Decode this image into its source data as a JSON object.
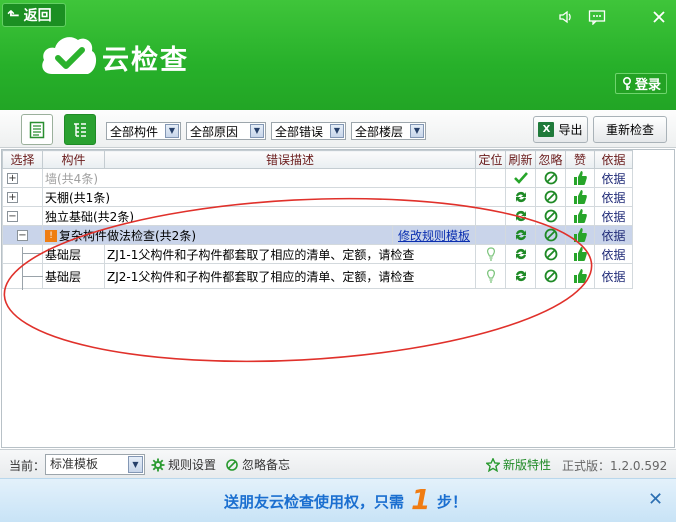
{
  "header": {
    "back_label": "返回",
    "title": "云检查",
    "login_label": "登录",
    "controls": [
      "speaker-icon",
      "message-icon",
      "close-icon"
    ],
    "bg_color": "#2bb22d"
  },
  "toolbar": {
    "filters": [
      "全部构件",
      "全部原因",
      "全部错误",
      "全部楼层"
    ],
    "export_label": "导出",
    "recheck_label": "重新检查"
  },
  "table": {
    "columns": [
      "选择",
      "构件",
      "错误描述",
      "定位",
      "刷新",
      "忽略",
      "赞",
      "依据"
    ],
    "rows": [
      {
        "component": "墙(共4条)",
        "grayed": true,
        "basis": "依据"
      },
      {
        "component": "天棚(共1条)",
        "basis": "依据"
      },
      {
        "component": "独立基础(共2条)",
        "basis": "依据"
      },
      {
        "group": "复杂构件做法检查(共2条)",
        "link": "修改规则模板",
        "basis": "依据"
      },
      {
        "component": "基础层",
        "description": "ZJ1-1父构件和子构件都套取了相应的清单、定额，请检查",
        "basis": "依据"
      },
      {
        "component": "基础层",
        "description": "ZJ2-1父构件和子构件都套取了相应的清单、定额，请检查",
        "basis": "依据"
      }
    ]
  },
  "footer": {
    "current_label": "当前：",
    "template_value": "标准模板",
    "rule_settings_label": "规则设置",
    "ignore_notes_label": "忽略备忘",
    "new_features_label": "新版特性",
    "version_label": "正式版：1.2.0.592"
  },
  "banner": {
    "text": "送朋友云检查使用权，只需",
    "number": "1",
    "suffix": "步！"
  }
}
